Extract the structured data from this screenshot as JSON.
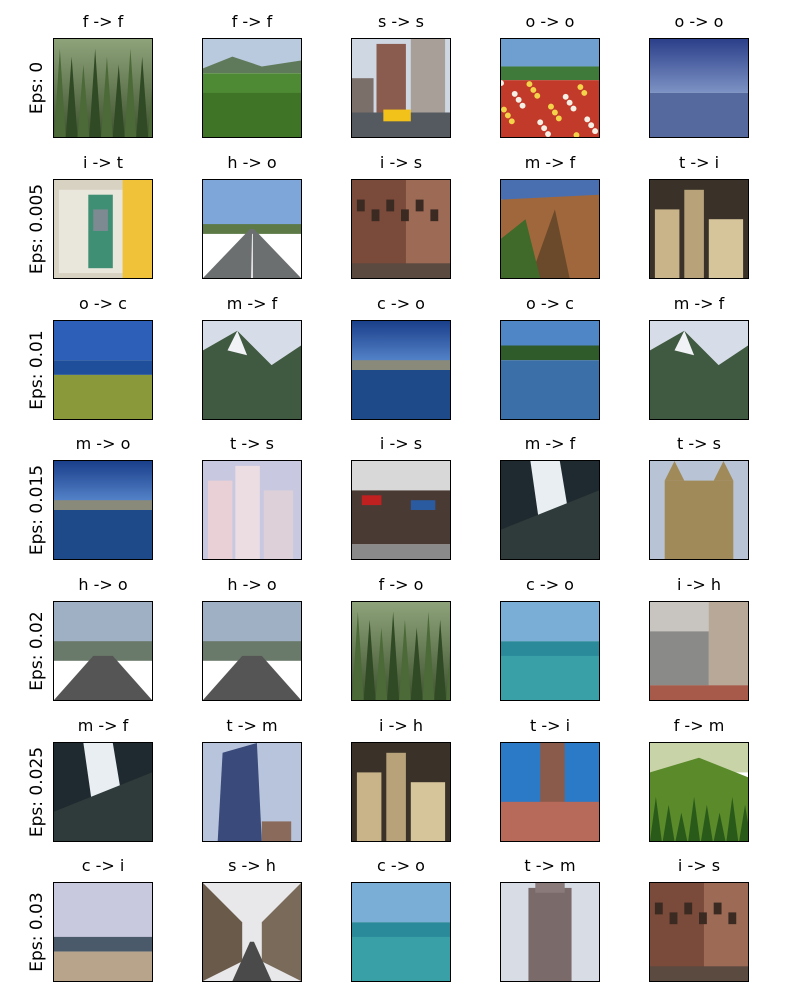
{
  "chart_data": {
    "type": "image-grid",
    "row_label_prefix": "Eps: ",
    "rows": [
      {
        "eps": "0",
        "cells": [
          "f -> f",
          "f -> f",
          "s -> s",
          "o -> o",
          "o -> o"
        ]
      },
      {
        "eps": "0.005",
        "cells": [
          "i -> t",
          "h -> o",
          "i -> s",
          "m -> f",
          "t -> i"
        ]
      },
      {
        "eps": "0.01",
        "cells": [
          "o -> c",
          "m -> f",
          "c -> o",
          "o -> c",
          "m -> f"
        ]
      },
      {
        "eps": "0.015",
        "cells": [
          "m -> o",
          "t -> s",
          "i -> s",
          "m -> f",
          "t -> s"
        ]
      },
      {
        "eps": "0.02",
        "cells": [
          "h -> o",
          "h -> o",
          "f -> o",
          "c -> o",
          "i -> h"
        ]
      },
      {
        "eps": "0.025",
        "cells": [
          "m -> f",
          "t -> m",
          "i -> h",
          "t -> i",
          "f -> m"
        ]
      },
      {
        "eps": "0.03",
        "cells": [
          "c -> i",
          "s -> h",
          "c -> o",
          "t -> m",
          "i -> s"
        ]
      }
    ],
    "scenes": [
      [
        "forest",
        "field",
        "street",
        "flowers",
        "plain"
      ],
      [
        "booth",
        "highway",
        "buildings",
        "canyon",
        "city"
      ],
      [
        "coast",
        "mountain",
        "lake",
        "river",
        "mountain"
      ],
      [
        "lake",
        "towers",
        "shops",
        "waterfall",
        "cathedral"
      ],
      [
        "road",
        "road",
        "forest",
        "sea",
        "station"
      ],
      [
        "waterfall",
        "tower",
        "city",
        "clocktower",
        "hills"
      ],
      [
        "beach",
        "avenue",
        "sea",
        "skyscraper",
        "buildings"
      ]
    ]
  }
}
